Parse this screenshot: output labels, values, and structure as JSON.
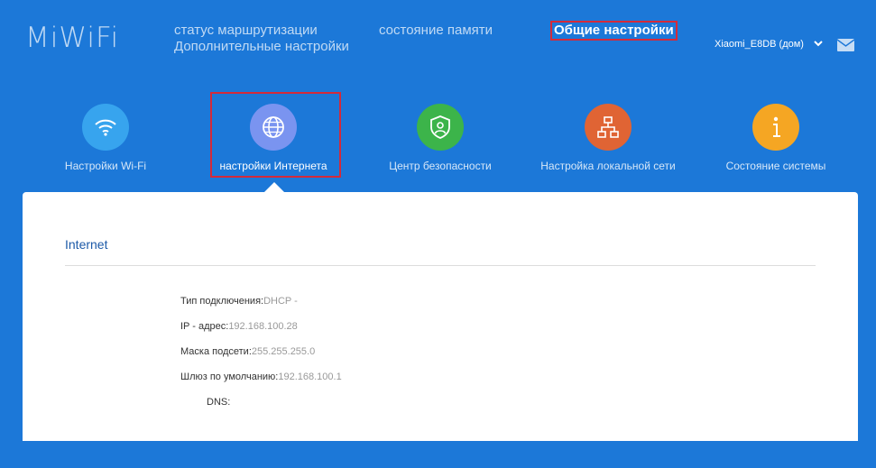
{
  "logo": "MiWiFi",
  "nav": {
    "routing_status": "статус маршрутизации",
    "storage_status": "состояние памяти",
    "advanced": "Дополнительные настройки",
    "general": "Общие настройки"
  },
  "router": {
    "name": "Xiaomi_E8DB (дом)"
  },
  "tiles": [
    {
      "label": "Настройки Wi-Fi",
      "color": "#37a4ee",
      "icon": "wifi-icon"
    },
    {
      "label": "настройки Интернета",
      "color": "#7a94f0",
      "icon": "globe-icon"
    },
    {
      "label": "Центр безопасности",
      "color": "#3cb44a",
      "icon": "shield-icon"
    },
    {
      "label": "Настройка локальной сети",
      "color": "#e06434",
      "icon": "network-icon"
    },
    {
      "label": "Состояние системы",
      "color": "#f5a623",
      "icon": "info-icon"
    }
  ],
  "panel": {
    "title": "Internet",
    "rows": [
      {
        "label": "Тип подключения:",
        "value": "DHCP -"
      },
      {
        "label": "IP - адрес:",
        "value": "192.168.100.28"
      },
      {
        "label": "Маска подсети:",
        "value": "255.255.255.0"
      },
      {
        "label": "Шлюз по умолчанию:",
        "value": "192.168.100.1"
      },
      {
        "label": "DNS:",
        "value": ""
      }
    ]
  }
}
